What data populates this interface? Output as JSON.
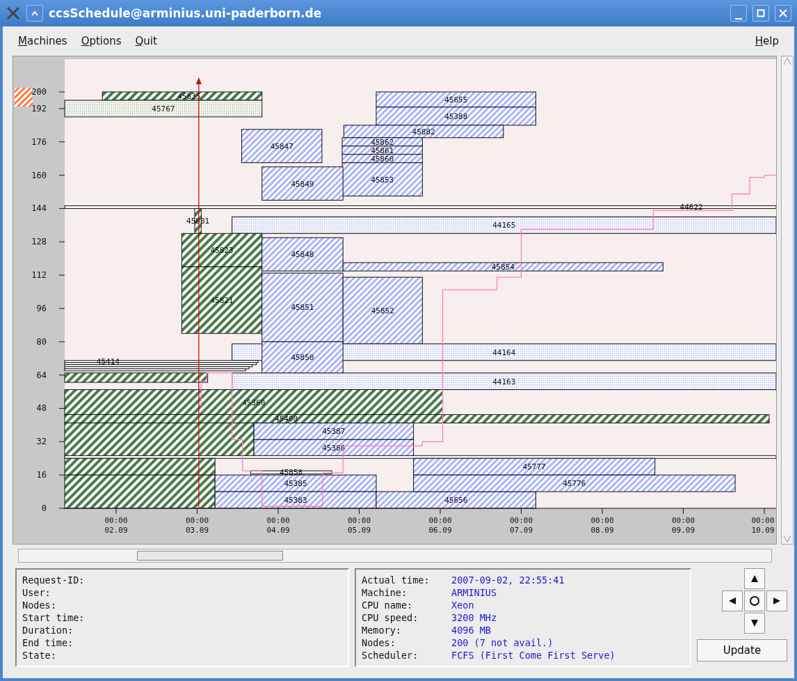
{
  "window": {
    "title": "ccsSchedule@arminius.uni-paderborn.de"
  },
  "menu": {
    "left": [
      {
        "label": "Machines"
      },
      {
        "label": "Options"
      },
      {
        "label": "Quit"
      }
    ],
    "right": [
      {
        "label": "Help"
      }
    ]
  },
  "schedule": {
    "y_axis_labels": [
      "200",
      "192",
      "176",
      "160",
      "144",
      "128",
      "112",
      "96",
      "80",
      "64",
      "48",
      "32",
      "16",
      "0"
    ],
    "x_axis_labels": [
      {
        "time": "00:00",
        "date": "02.09"
      },
      {
        "time": "00:00",
        "date": "03.09"
      },
      {
        "time": "00:00",
        "date": "04.09"
      },
      {
        "time": "00:00",
        "date": "05.09"
      },
      {
        "time": "00:00",
        "date": "06.09"
      },
      {
        "time": "00:00",
        "date": "07.09"
      },
      {
        "time": "00:00",
        "date": "08.09"
      },
      {
        "time": "00:00",
        "date": "09.09"
      },
      {
        "time": "00:00",
        "date": "10.09"
      }
    ],
    "jobs": [
      {
        "label": "45835",
        "kind": "running"
      },
      {
        "label": "45767",
        "kind": "reserved"
      },
      {
        "label": "45655",
        "kind": "planned"
      },
      {
        "label": "45388",
        "kind": "planned"
      },
      {
        "label": "45882",
        "kind": "planned"
      },
      {
        "label": "45862",
        "kind": "planned"
      },
      {
        "label": "45861",
        "kind": "planned"
      },
      {
        "label": "45860",
        "kind": "planned"
      },
      {
        "label": "45853",
        "kind": "planned"
      },
      {
        "label": "45847",
        "kind": "planned"
      },
      {
        "label": "45849",
        "kind": "planned"
      },
      {
        "label": "44622",
        "kind": "blocked"
      },
      {
        "label": "45881",
        "kind": "running"
      },
      {
        "label": "44165",
        "kind": "reservation"
      },
      {
        "label": "45823",
        "kind": "running"
      },
      {
        "label": "45821",
        "kind": "running"
      },
      {
        "label": "45848",
        "kind": "planned"
      },
      {
        "label": "45854",
        "kind": "planned"
      },
      {
        "label": "45851",
        "kind": "planned"
      },
      {
        "label": "45852",
        "kind": "planned"
      },
      {
        "label": "44164",
        "kind": "reservation"
      },
      {
        "label": "45850",
        "kind": "planned"
      },
      {
        "label": "44163",
        "kind": "reservation"
      },
      {
        "label": "45414",
        "kind": "blocked"
      },
      {
        "kind": "blocked"
      },
      {
        "kind": "blocked"
      },
      {
        "kind": "blocked"
      },
      {
        "kind": "blocked"
      },
      {
        "kind": "running"
      },
      {
        "label": "45360",
        "kind": "running"
      },
      {
        "label": "45400",
        "kind": "running"
      },
      {
        "kind": "running"
      },
      {
        "label": "45387",
        "kind": "planned"
      },
      {
        "label": "45386",
        "kind": "planned"
      },
      {
        "kind": "blocked"
      },
      {
        "kind": "running"
      },
      {
        "kind": "running"
      },
      {
        "label": "45858",
        "kind": "blocked"
      },
      {
        "label": "45385",
        "kind": "planned"
      },
      {
        "label": "45383",
        "kind": "planned"
      },
      {
        "label": "45656",
        "kind": "planned"
      },
      {
        "label": "45777",
        "kind": "planned"
      },
      {
        "label": "45776",
        "kind": "planned"
      }
    ]
  },
  "request": {
    "rows": [
      {
        "label": "Request-ID:"
      },
      {
        "label": "User:"
      },
      {
        "label": "Nodes:"
      },
      {
        "label": "Start time:"
      },
      {
        "label": "Duration:"
      },
      {
        "label": "End time:"
      },
      {
        "label": "State:"
      }
    ]
  },
  "machine": {
    "rows": [
      {
        "label": "Actual time:",
        "value": "2007-09-02, 22:55:41"
      },
      {
        "label": "Machine:",
        "value": "ARMINIUS"
      },
      {
        "label": "CPU name:",
        "value": "Xeon"
      },
      {
        "label": "CPU speed:",
        "value": "3200 MHz"
      },
      {
        "label": "Memory:",
        "value": "4096 MB"
      },
      {
        "label": "Nodes:",
        "value": "200 (7 not avail.)"
      },
      {
        "label": "Scheduler:",
        "value": "FCFS (First Come First Serve)"
      }
    ]
  },
  "navigation": {
    "update_button": "Update"
  }
}
